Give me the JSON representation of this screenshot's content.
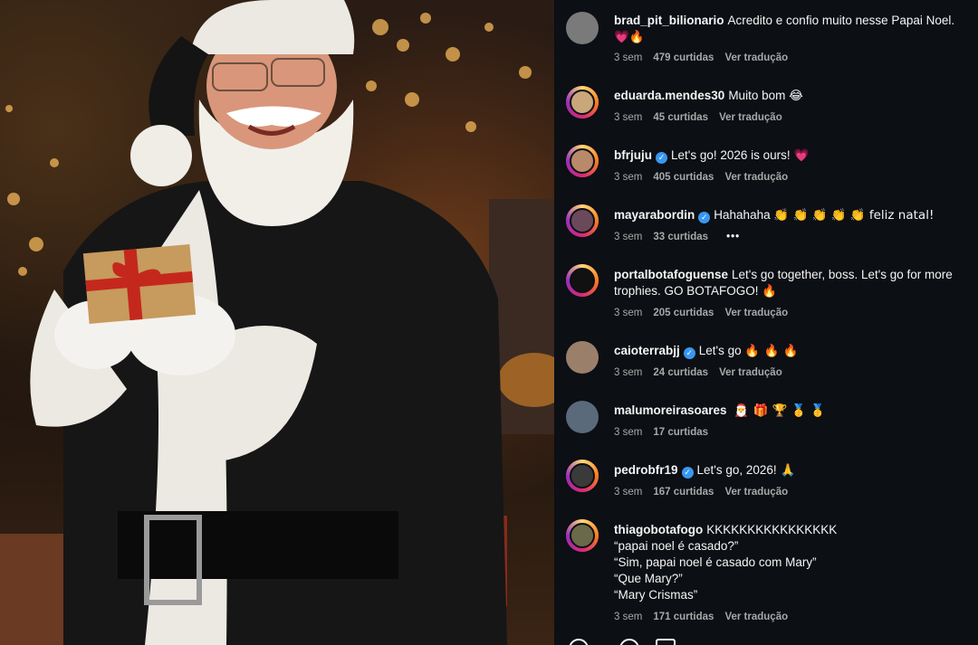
{
  "comments": [
    {
      "user": "brad_pit_bilionario",
      "verified": false,
      "text": "Acredito e confio muito nesse Papai Noel.",
      "emoji": "💗🔥",
      "time": "3 sem",
      "likes": "479 curtidas",
      "translate": "Ver tradução",
      "avatar_color": "#7a7a7a",
      "story": false
    },
    {
      "user": "eduarda.mendes30",
      "verified": false,
      "text": "Muito bom",
      "emoji": "😂",
      "time": "3 sem",
      "likes": "45 curtidas",
      "translate": "Ver tradução",
      "avatar_color": "#c9a77a",
      "story": true
    },
    {
      "user": "bfrjuju",
      "verified": true,
      "text": "Let's go! 2026 is ours!",
      "emoji": "💗",
      "time": "3 sem",
      "likes": "405 curtidas",
      "translate": "Ver tradução",
      "avatar_color": "#b98a6a",
      "story": true
    },
    {
      "user": "mayarabordin",
      "verified": true,
      "text": "Hahahaha",
      "emoji": "👏 👏 👏 👏 👏 feliz natal!",
      "time": "3 sem",
      "likes": "33 curtidas",
      "translate": "•••",
      "avatar_color": "#6a4a5a",
      "story": true
    },
    {
      "user": "portalbotafoguense",
      "verified": false,
      "text": "Let's go together, boss. Let's go for more trophies. GO BOTAFOGO!",
      "emoji": "🔥",
      "time": "3 sem",
      "likes": "205 curtidas",
      "translate": "Ver tradução",
      "avatar_color": "#111111",
      "story": true
    },
    {
      "user": "caioterrabjj",
      "verified": true,
      "text": "Let's go",
      "emoji": "🔥 🔥 🔥",
      "time": "3 sem",
      "likes": "24 curtidas",
      "translate": "Ver tradução",
      "avatar_color": "#9a7f6a",
      "story": false
    },
    {
      "user": "malumoreirasoares",
      "verified": false,
      "text": "",
      "emoji": "🎅 🎁 🏆 🥇 🥇",
      "time": "3 sem",
      "likes": "17 curtidas",
      "translate": "",
      "avatar_color": "#5a6a7a",
      "story": false
    },
    {
      "user": "pedrobfr19",
      "verified": true,
      "text": "Let's go, 2026!",
      "emoji": "🙏",
      "time": "3 sem",
      "likes": "167 curtidas",
      "translate": "Ver tradução",
      "avatar_color": "#3a3a3a",
      "story": true
    },
    {
      "user": "thiagobotafogo",
      "verified": false,
      "text": "KKKKKKKKKKKKKKKK",
      "lines": [
        "“papai noel é casado?”",
        "“Sim, papai noel é casado com Mary”",
        "“Que Mary?”",
        "“Mary Crismas”"
      ],
      "emoji": "",
      "time": "3 sem",
      "likes": "171 curtidas",
      "translate": "Ver tradução",
      "avatar_color": "#6a6a4a",
      "story": true
    }
  ],
  "photo": {
    "subject": "santa-claus-portrait"
  },
  "colors": {
    "panel_bg": "#0c0f14",
    "verified": "#3897f0",
    "meta": "#a8a8a8"
  }
}
